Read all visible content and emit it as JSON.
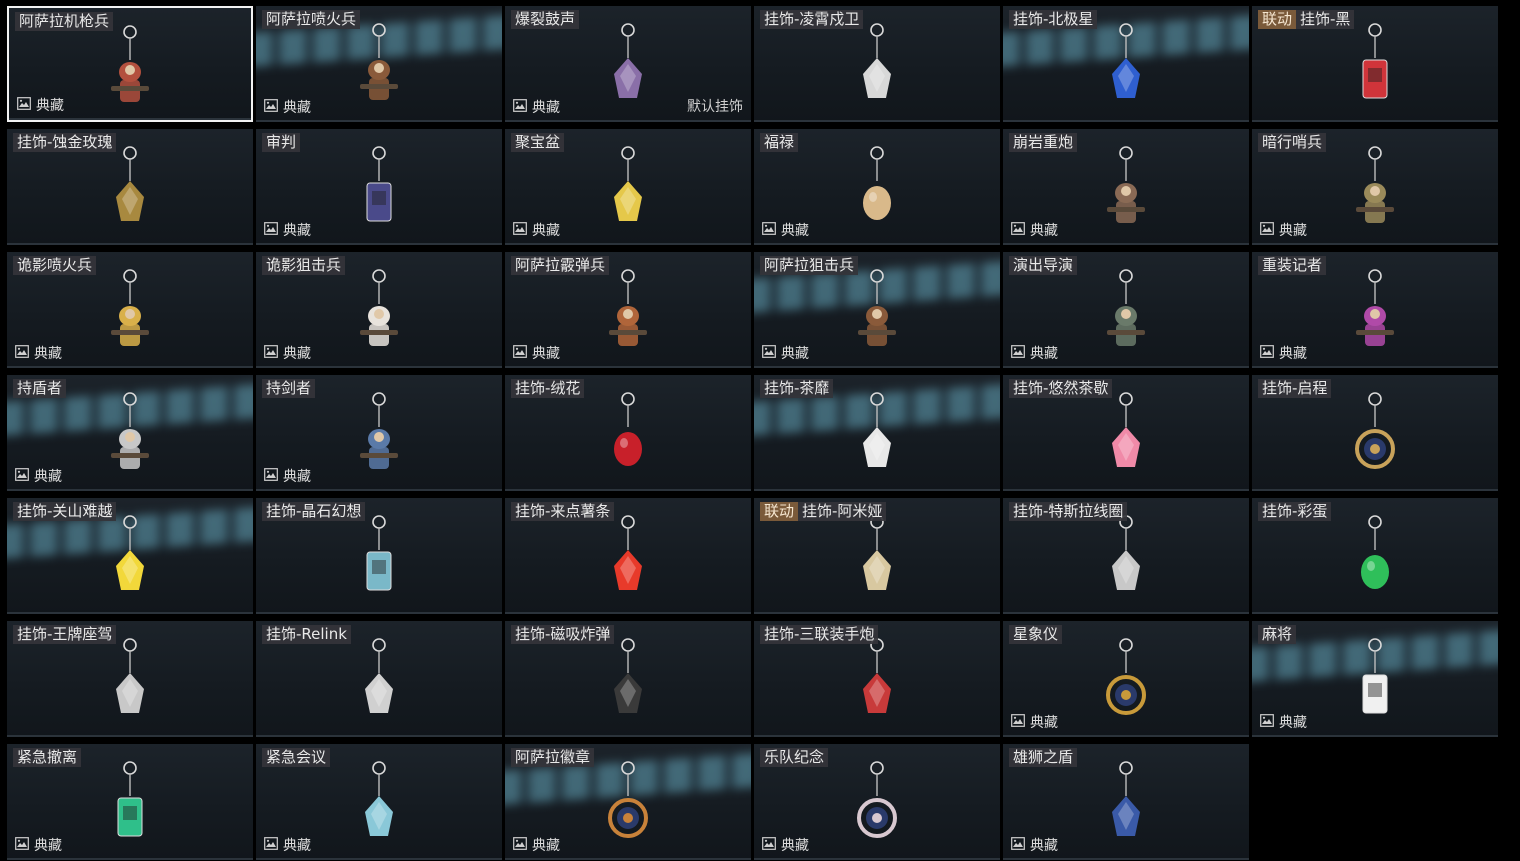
{
  "collection_label": "典藏",
  "default_label": "默认挂饰",
  "collab_label": "联动",
  "items": [
    {
      "name": "阿萨拉机枪兵",
      "collection": true,
      "selected": true,
      "icon": "soldier-figure-icon",
      "color": "#b3503e"
    },
    {
      "name": "阿萨拉喷火兵",
      "collection": true,
      "glow": true,
      "icon": "soldier-figure-icon",
      "color": "#8a5a3a"
    },
    {
      "name": "爆裂鼓声",
      "collection": true,
      "default": true,
      "icon": "drummer-charm-icon",
      "color": "#8a6fa8"
    },
    {
      "name": "挂饰-凌霄戍卫",
      "icon": "rocket-charm-icon",
      "color": "#d8d8d8"
    },
    {
      "name": "挂饰-北极星",
      "glow": true,
      "icon": "star-charm-icon",
      "color": "#2f5fd0"
    },
    {
      "name": "挂饰-黑",
      "collab": true,
      "icon": "tag-charm-icon",
      "color": "#d0343a"
    },
    {
      "name": "挂饰-蚀金玫瑰",
      "icon": "rose-emblem-charm-icon",
      "color": "#a8893f"
    },
    {
      "name": "审判",
      "collection": true,
      "icon": "card-charm-icon",
      "color": "#4a4a8a"
    },
    {
      "name": "聚宝盆",
      "collection": true,
      "icon": "treasure-bowl-charm-icon",
      "color": "#e5c84a"
    },
    {
      "name": "福禄",
      "collection": true,
      "icon": "gourd-charm-icon",
      "color": "#d9b98a"
    },
    {
      "name": "崩岩重炮",
      "collection": true,
      "icon": "soldier-figure-icon",
      "color": "#8a6a55"
    },
    {
      "name": "暗行哨兵",
      "collection": true,
      "icon": "soldier-figure-icon",
      "color": "#9a8a5a"
    },
    {
      "name": "诡影喷火兵",
      "collection": true,
      "icon": "soldier-figure-icon",
      "color": "#d9b04a"
    },
    {
      "name": "诡影狙击兵",
      "collection": true,
      "icon": "mask-figure-icon",
      "color": "#e8e3dc"
    },
    {
      "name": "阿萨拉霰弹兵",
      "collection": true,
      "icon": "soldier-figure-icon",
      "color": "#b0653a"
    },
    {
      "name": "阿萨拉狙击兵",
      "collection": true,
      "glow": true,
      "icon": "soldier-figure-icon",
      "color": "#8a5a3a"
    },
    {
      "name": "演出导演",
      "collection": true,
      "icon": "director-figure-icon",
      "color": "#6a7a6a"
    },
    {
      "name": "重装记者",
      "collection": true,
      "icon": "reporter-figure-icon",
      "color": "#b04aa8"
    },
    {
      "name": "持盾者",
      "collection": true,
      "glow": true,
      "icon": "shield-bearer-figure-icon",
      "color": "#c8c8c8"
    },
    {
      "name": "持剑者",
      "collection": true,
      "icon": "sword-bearer-figure-icon",
      "color": "#5a7aa8"
    },
    {
      "name": "挂饰-绒花",
      "icon": "flower-charm-icon",
      "color": "#c8202a"
    },
    {
      "name": "挂饰-茶靡",
      "glow": true,
      "icon": "fairy-charm-icon",
      "color": "#e8e8e8"
    },
    {
      "name": "挂饰-悠然茶歇",
      "icon": "cupcake-charm-icon",
      "color": "#f08aa8"
    },
    {
      "name": "挂饰-启程",
      "icon": "compass-medal-charm-icon",
      "color": "#c8a25a"
    },
    {
      "name": "挂饰-关山难越",
      "glow": true,
      "icon": "lighter-charm-icon",
      "color": "#f2d83a"
    },
    {
      "name": "挂饰-晶石幻想",
      "icon": "gem-tile-charm-icon",
      "color": "#7ab8c8"
    },
    {
      "name": "挂饰-来点薯条",
      "icon": "fries-charm-icon",
      "color": "#e83a2a"
    },
    {
      "name": "挂饰-阿米娅",
      "collab": true,
      "icon": "bunny-charm-icon",
      "color": "#d8c8a0"
    },
    {
      "name": "挂饰-特斯拉线圈",
      "icon": "tesla-coil-charm-icon",
      "color": "#c8c8c8"
    },
    {
      "name": "挂饰-彩蛋",
      "icon": "egg-charm-icon",
      "color": "#2fbf5a"
    },
    {
      "name": "挂饰-王牌座驾",
      "icon": "jet-charm-icon",
      "color": "#c8c8c8"
    },
    {
      "name": "挂饰-Relink",
      "icon": "relink-logo-charm-icon",
      "color": "#d0d0d0"
    },
    {
      "name": "挂饰-磁吸炸弹",
      "icon": "bomb-charm-icon",
      "color": "#3a3a3a"
    },
    {
      "name": "挂饰-三联装手炮",
      "icon": "launcher-charm-icon",
      "color": "#c83a3a"
    },
    {
      "name": "星象仪",
      "collection": true,
      "icon": "astrolabe-charm-icon",
      "color": "#c89a3a"
    },
    {
      "name": "麻将",
      "collection": true,
      "glow": true,
      "icon": "mahjong-tile-charm-icon",
      "color": "#f0f0f0"
    },
    {
      "name": "紧急撤离",
      "collection": true,
      "icon": "exit-sign-charm-icon",
      "color": "#2fbf8a"
    },
    {
      "name": "紧急会议",
      "collection": true,
      "icon": "meeting-charm-icon",
      "color": "#8ac8d8"
    },
    {
      "name": "阿萨拉徽章",
      "collection": true,
      "glow": true,
      "icon": "badge-medal-charm-icon",
      "color": "#c8823a"
    },
    {
      "name": "乐队纪念",
      "collection": true,
      "icon": "band-medal-charm-icon",
      "color": "#d8c8d0"
    },
    {
      "name": "雄狮之盾",
      "collection": true,
      "icon": "lion-shield-charm-icon",
      "color": "#3a5aa8"
    }
  ]
}
